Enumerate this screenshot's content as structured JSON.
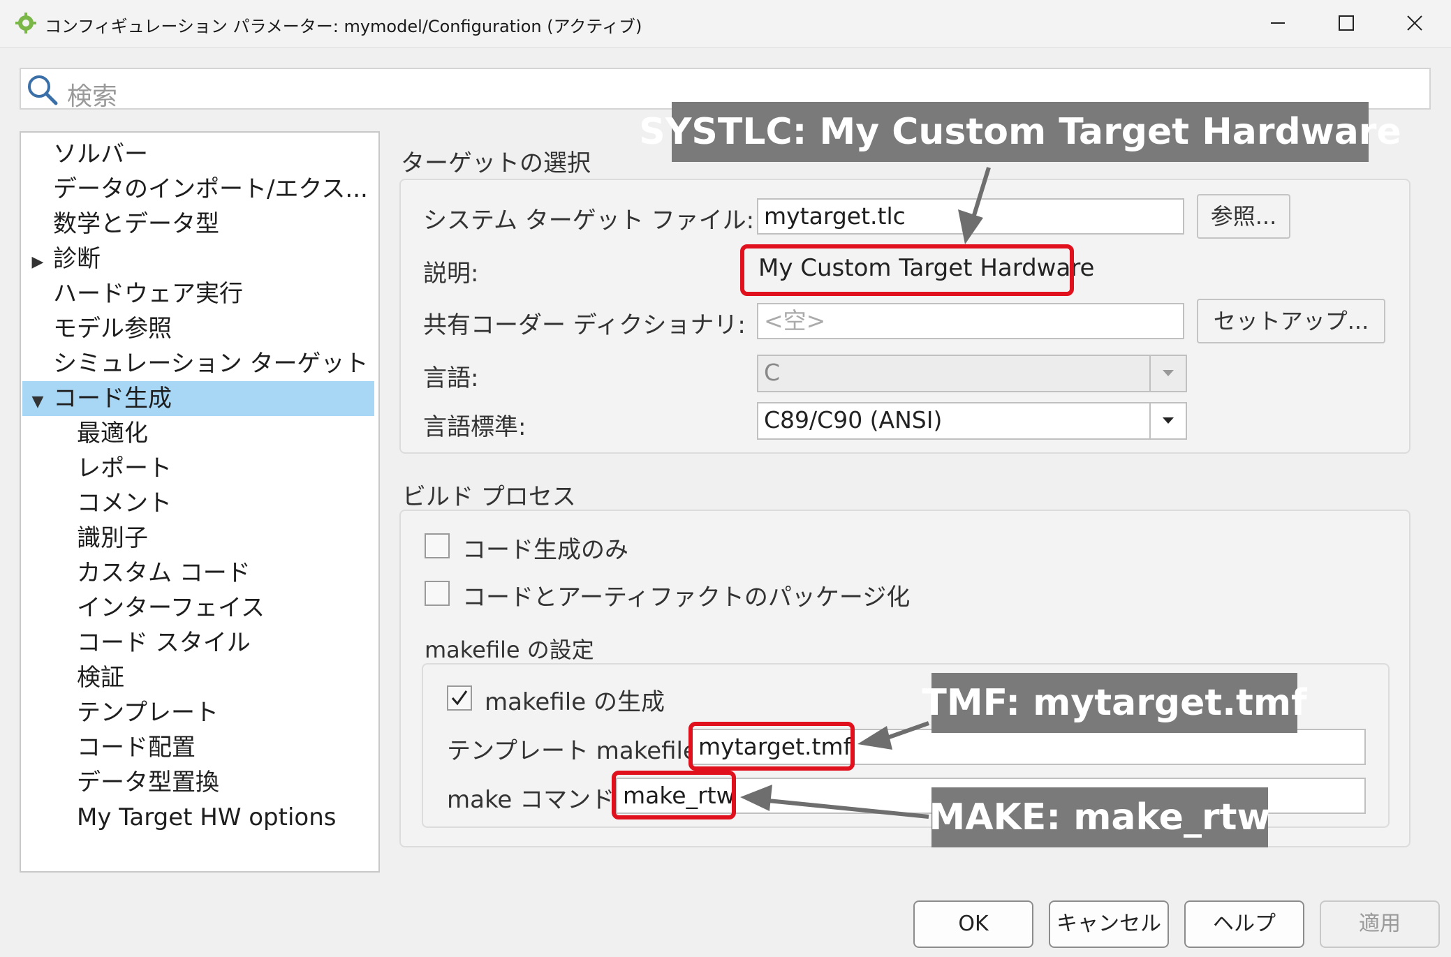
{
  "window": {
    "title": "コンフィギュレーション パラメーター: mymodel/Configuration (アクティブ)",
    "icon": "gear-app-icon",
    "controls": {
      "minimize": "minimize-icon",
      "maximize": "maximize-icon",
      "close": "close-icon"
    }
  },
  "search": {
    "placeholder": "検索",
    "icon": "search-icon"
  },
  "tree": {
    "items": [
      {
        "label": "ソルバー",
        "level": 0
      },
      {
        "label": "データのインポート/エクス...",
        "level": 0
      },
      {
        "label": "数学とデータ型",
        "level": 0
      },
      {
        "label": "診断",
        "level": 0,
        "arrow": "▶"
      },
      {
        "label": "ハードウェア実行",
        "level": 0
      },
      {
        "label": "モデル参照",
        "level": 0
      },
      {
        "label": "シミュレーション ターゲット",
        "level": 0
      },
      {
        "label": "コード生成",
        "level": 0,
        "arrow": "▼",
        "selected": true
      },
      {
        "label": "最適化",
        "level": 1
      },
      {
        "label": "レポート",
        "level": 1
      },
      {
        "label": "コメント",
        "level": 1
      },
      {
        "label": "識別子",
        "level": 1
      },
      {
        "label": "カスタム コード",
        "level": 1
      },
      {
        "label": "インターフェイス",
        "level": 1
      },
      {
        "label": "コード スタイル",
        "level": 1
      },
      {
        "label": "検証",
        "level": 1
      },
      {
        "label": "テンプレート",
        "level": 1
      },
      {
        "label": "コード配置",
        "level": 1
      },
      {
        "label": "データ型置換",
        "level": 1
      },
      {
        "label": "My Target HW options",
        "level": 1
      }
    ]
  },
  "target": {
    "section_title": "ターゲットの選択",
    "system_target_label": "システム ターゲット ファイル:",
    "system_target_value": "mytarget.tlc",
    "browse_label": "参照...",
    "description_label": "説明:",
    "description_value": "My Custom Target Hardware",
    "shared_dict_label": "共有コーダー ディクショナリ:",
    "shared_dict_placeholder": "<空>",
    "setup_label": "セットアップ...",
    "language_label": "言語:",
    "language_value": "C",
    "language_std_label": "言語標準:",
    "language_std_value": "C89/C90 (ANSI)"
  },
  "build": {
    "section_title": "ビルド プロセス",
    "codegen_only_label": "コード生成のみ",
    "codegen_only_checked": false,
    "package_label": "コードとアーティファクトのパッケージ化",
    "package_checked": false,
    "makefile_section_title": "makefile の設定",
    "gen_makefile_label": "makefile の生成",
    "gen_makefile_checked": true,
    "template_makefile_label": "テンプレート makefile:",
    "template_makefile_value": "mytarget.tmf",
    "make_command_label": "make コマンド:",
    "make_command_value": "make_rtw"
  },
  "annotations": {
    "systlc": "SYSTLC: My Custom Target Hardware",
    "tmf": "TMF: mytarget.tmf",
    "make": "MAKE: make_rtw",
    "highlight_color": "#e0101c",
    "callout_color": "#7a7a7a"
  },
  "footer": {
    "ok": "OK",
    "cancel": "キャンセル",
    "help": "ヘルプ",
    "apply": "適用"
  }
}
